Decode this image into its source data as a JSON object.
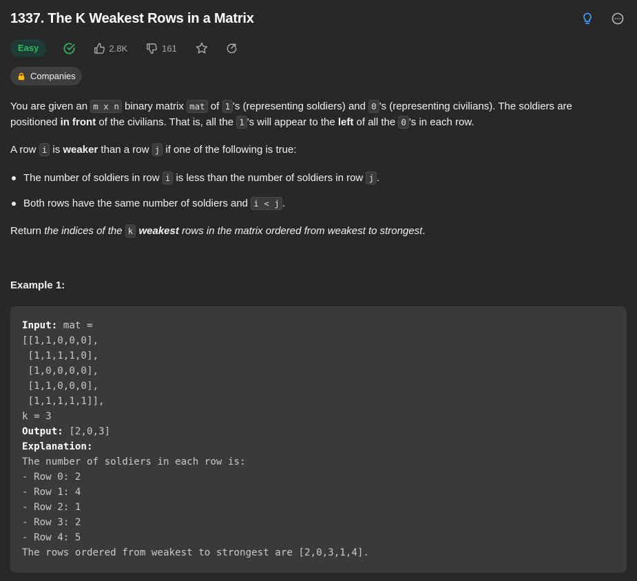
{
  "problem": {
    "title": "1337. The K Weakest Rows in a Matrix",
    "difficulty": "Easy",
    "likes": "2.8K",
    "dislikes": "161",
    "companies_label": "Companies"
  },
  "icons": {
    "hint": "lightbulb-icon",
    "more": "ellipsis-circle-icon",
    "solved": "check-circle-icon",
    "like": "thumbs-up-icon",
    "dislike": "thumbs-down-icon",
    "favorite": "star-icon",
    "share": "share-icon",
    "lock": "lock-icon"
  },
  "colors": {
    "background": "#282828",
    "easy_green": "#2cbb5d",
    "hint_blue": "#3b9cff",
    "code_block_bg": "#3a3a3a"
  },
  "description": {
    "p1": {
      "t1": "You are given an ",
      "c1": "m x n",
      "t2": " binary matrix ",
      "c2": "mat",
      "t3": " of ",
      "c3": "1",
      "t4": "'s (representing soldiers) and ",
      "c4": "0",
      "t5": "'s (representing civilians). The soldiers are positioned ",
      "b1": "in front",
      "t6": " of the civilians. That is, all the ",
      "c5": "1",
      "t7": "'s will appear to the ",
      "b2": "left",
      "t8": " of all the ",
      "c6": "0",
      "t9": "'s in each row."
    },
    "p2": {
      "t1": "A row ",
      "c1": "i",
      "t2": " is ",
      "b1": "weaker",
      "t3": " than a row ",
      "c2": "j",
      "t4": " if one of the following is true:"
    },
    "bullet1": {
      "t1": "The number of soldiers in row ",
      "c1": "i",
      "t2": " is less than the number of soldiers in row ",
      "c2": "j",
      "t3": "."
    },
    "bullet2": {
      "t1": "Both rows have the same number of soldiers and ",
      "c1": "i < j",
      "t2": "."
    },
    "p3": {
      "t1": "Return ",
      "i1": "the indices of the ",
      "c1": "k",
      "b1": "weakest",
      "i2": " rows in the matrix ordered from weakest to strongest",
      "t2": "."
    }
  },
  "example": {
    "heading": "Example 1:",
    "input_label": "Input:",
    "input_lines": [
      " mat =",
      "[[1,1,0,0,0],",
      " [1,1,1,1,0],",
      " [1,0,0,0,0],",
      " [1,1,0,0,0],",
      " [1,1,1,1,1]],",
      "k = 3"
    ],
    "output_label": "Output:",
    "output_value": " [2,0,3]",
    "explanation_label": "Explanation:",
    "explanation_lines": [
      "The number of soldiers in each row is:",
      "- Row 0: 2",
      "- Row 1: 4",
      "- Row 2: 1",
      "- Row 3: 2",
      "- Row 4: 5",
      "The rows ordered from weakest to strongest are [2,0,3,1,4]."
    ]
  }
}
